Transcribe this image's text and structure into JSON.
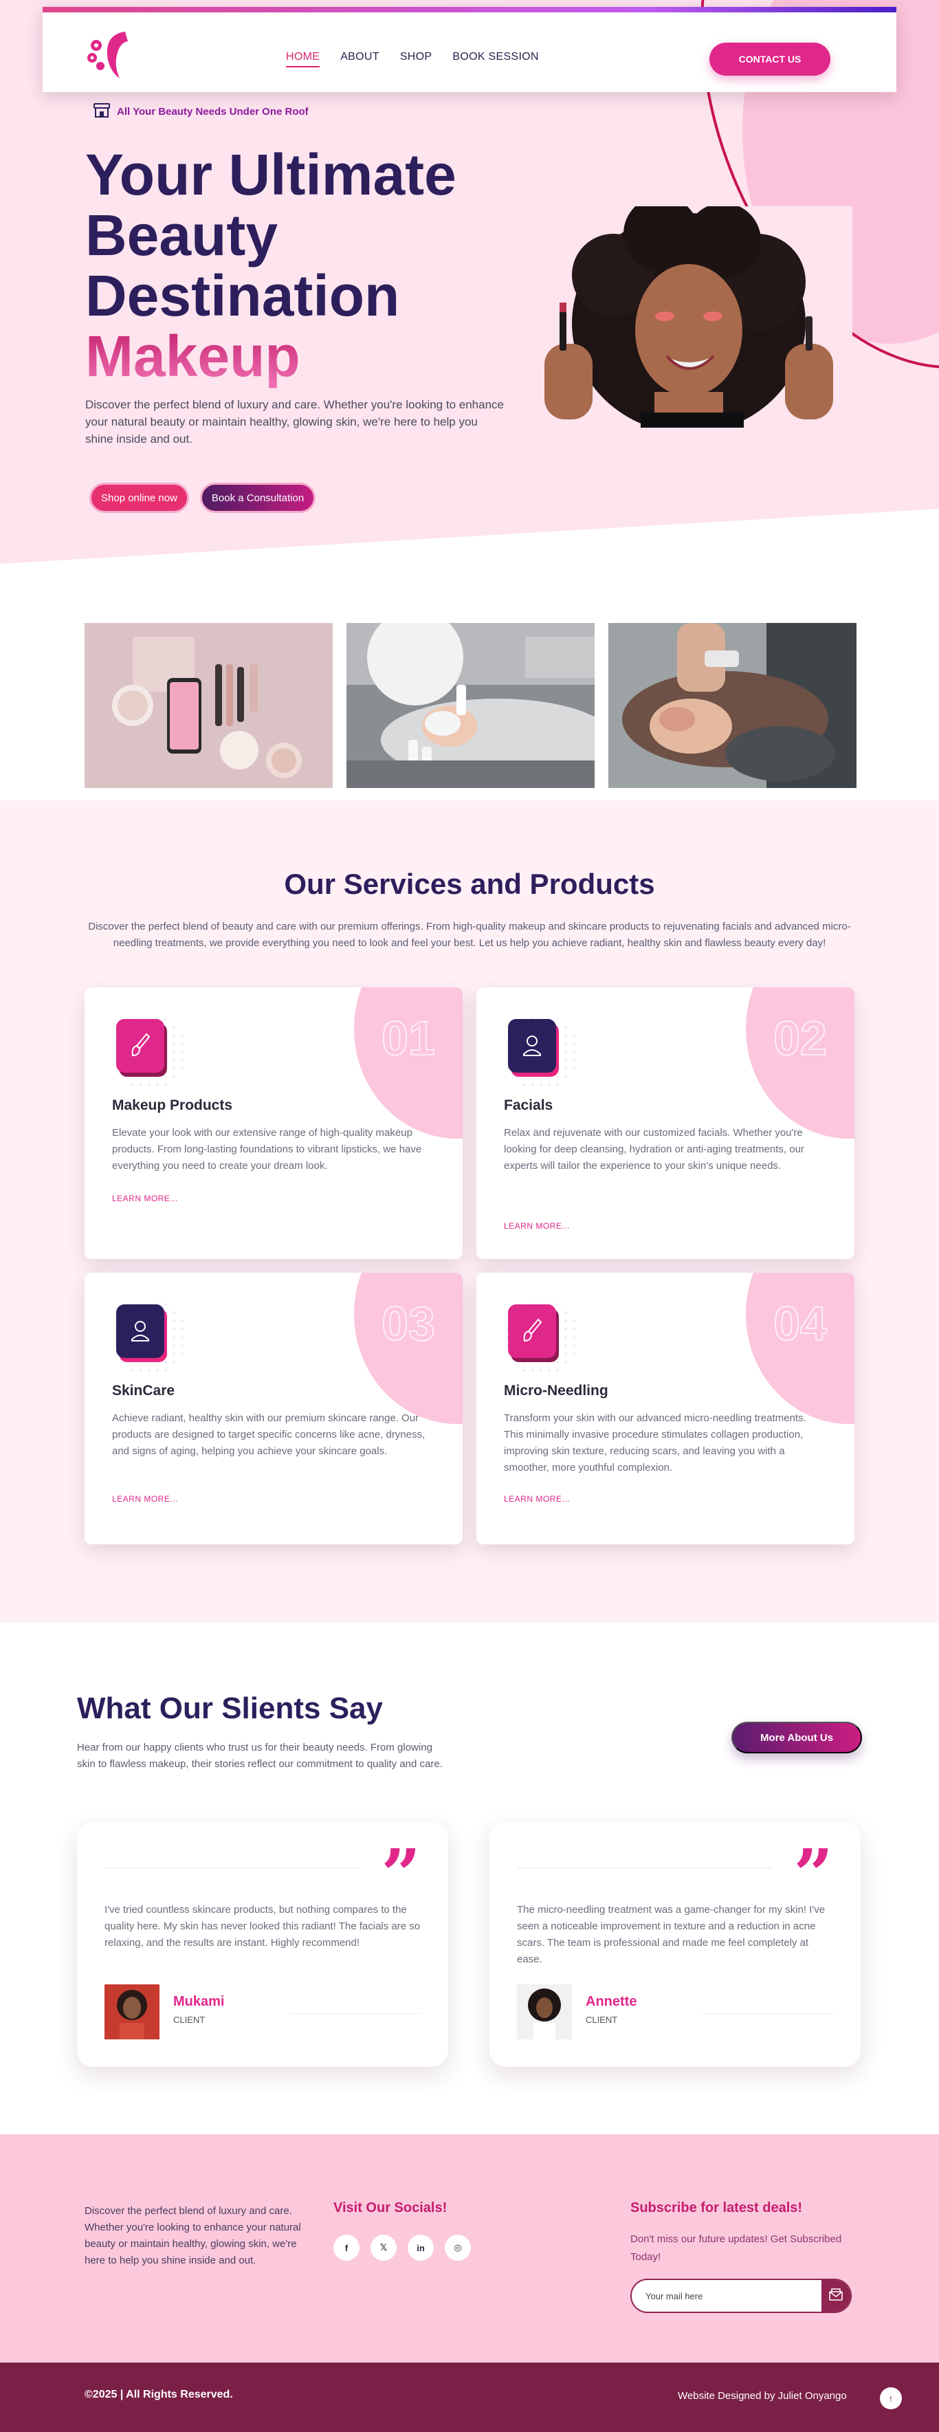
{
  "header": {
    "nav": [
      "HOME",
      "ABOUT",
      "SHOP",
      "BOOK SESSION"
    ],
    "active_nav": "HOME",
    "contact_label": "CONTACT US"
  },
  "hero": {
    "tagline": "All Your Beauty Needs Under One Roof",
    "title_lines": [
      "Your Ultimate",
      "Beauty",
      "Destination"
    ],
    "title_accent": "Makeup",
    "description": "Discover the perfect blend of luxury and care. Whether you're looking to enhance your natural beauty or maintain healthy, glowing skin, we're here to help you shine inside and out.",
    "btn_shop": "Shop online now",
    "btn_book": "Book a Consultation"
  },
  "services": {
    "title": "Our Services and Products",
    "description": "Discover the perfect blend of beauty and care with our premium offerings. From high-quality makeup and skincare products to rejuvenating facials and advanced micro-needling treatments, we provide everything you need to look and feel your best. Let us help you achieve radiant, healthy skin and flawless beauty every day!",
    "cards": [
      {
        "num": "01",
        "title": "Makeup Products",
        "icon": "brush-icon",
        "text": "Elevate your look with our extensive range of high-quality makeup products. From long-lasting foundations to vibrant lipsticks, we have everything you need to create your dream look.",
        "link": "LEARN MORE..."
      },
      {
        "num": "02",
        "title": "Facials",
        "icon": "person-icon",
        "text": "Relax and rejuvenate with our customized facials. Whether you're looking for deep cleansing, hydration or anti-aging treatments, our experts will tailor the experience to your skin's unique needs.",
        "link": "LEARN MORE..."
      },
      {
        "num": "03",
        "title": "SkinCare",
        "icon": "person-icon",
        "text": "Achieve radiant, healthy skin with our premium skincare range. Our products are designed to target specific concerns like acne, dryness, and signs of aging, helping you achieve your skincare goals.",
        "link": "LEARN MORE..."
      },
      {
        "num": "04",
        "title": "Micro-Needling",
        "icon": "brush-icon",
        "text": "Transform your skin with our advanced micro-needling treatments. This minimally invasive procedure stimulates collagen production, improving skin texture, reducing scars, and leaving you with a smoother, more youthful complexion.",
        "link": "LEARN MORE..."
      }
    ]
  },
  "testimonials": {
    "title": "What Our Slients Say",
    "description": "Hear from our happy clients who trust us for their beauty needs. From glowing skin to flawless makeup, their stories reflect our commitment to quality and care.",
    "more_btn": "More About Us",
    "items": [
      {
        "text": "I've tried countless skincare products, but nothing compares to the quality here. My skin has never looked this radiant! The facials are so relaxing, and the results are instant. Highly recommend!",
        "name": "Mukami",
        "role": "CLIENT"
      },
      {
        "text": "The micro-needling treatment was a game-changer for my skin! I've seen a noticeable improvement in texture and a reduction in acne scars. The team is professional and made me feel completely at ease.",
        "name": "Annette",
        "role": "CLIENT"
      }
    ]
  },
  "footer": {
    "description": "Discover the perfect blend of luxury and care. Whether you're looking to enhance your natural beauty or maintain healthy, glowing skin, we're here to help you shine inside and out.",
    "socials_title": "Visit Our Socials!",
    "socials": [
      "f",
      "𝕏",
      "in",
      "◎"
    ],
    "subscribe_title": "Subscribe for latest deals!",
    "subscribe_desc": "Don't miss our future updates! Get Subscribed Today!",
    "email_placeholder": "Your mail here",
    "copyright": "©2025 | All Rights Reserved.",
    "credit": "Website Designed by Juliet Onyango",
    "to_top": "↑"
  },
  "colors": {
    "primary_pink": "#e0278a",
    "navy": "#2d1f5c",
    "footer_bg": "#fcc8dc",
    "bottombar": "#7a2046"
  }
}
